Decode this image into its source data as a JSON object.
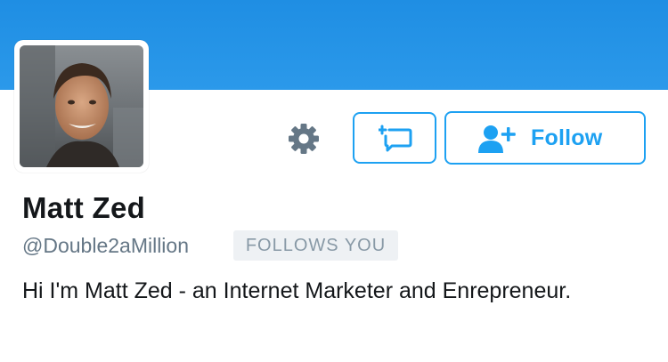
{
  "profile": {
    "display_name": "Matt Zed",
    "handle": "@Double2aMillion",
    "follows_you_badge": "FOLLOWS YOU",
    "bio": "Hi I'm Matt Zed - an Internet Marketer and Enrepreneur."
  },
  "actions": {
    "follow_label": "Follow"
  },
  "colors": {
    "banner": "#1f8ee3",
    "accent": "#1da1f2",
    "icon_gray": "#657786"
  },
  "icons": {
    "settings": "gear-icon",
    "message": "direct-message-icon",
    "follow": "add-user-icon"
  }
}
